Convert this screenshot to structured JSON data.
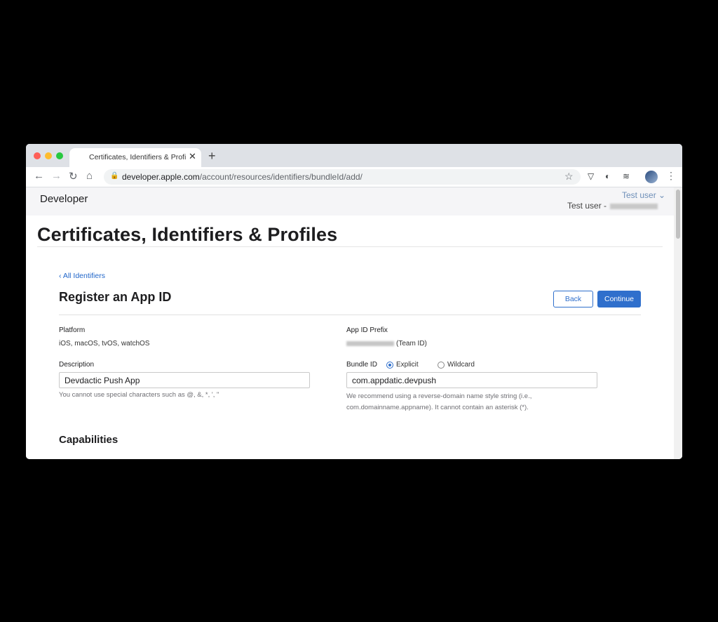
{
  "browser": {
    "tab_title": "Certificates, Identifiers & Profiles",
    "favicon": "apple-icon",
    "url_host": "developer.apple.com",
    "url_path": "/account/resources/identifiers/bundleId/add/"
  },
  "header": {
    "brand": "Developer",
    "user_menu": "Test user",
    "team_label": "Test user -"
  },
  "page": {
    "title": "Certificates, Identifiers & Profiles",
    "back_link": "‹ All Identifiers",
    "section_title": "Register an App ID",
    "back_button": "Back",
    "continue_button": "Continue"
  },
  "form": {
    "platform_label": "Platform",
    "platform_value": "iOS, macOS, tvOS, watchOS",
    "prefix_label": "App ID Prefix",
    "prefix_suffix": "(Team ID)",
    "description_label": "Description",
    "description_value": "Devdactic Push App",
    "description_hint": "You cannot use special characters such as @, &, *, ', \"",
    "bundle_label": "Bundle ID",
    "bundle_options": [
      "Explicit",
      "Wildcard"
    ],
    "bundle_selected": "Explicit",
    "bundle_value": "com.appdatic.devpush",
    "bundle_hint_1": "We recommend using a reverse-domain name style string (i.e.,",
    "bundle_hint_2": "com.domainname.appname). It cannot contain an asterisk (*).",
    "capabilities_title": "Capabilities"
  },
  "colors": {
    "accent": "#2f6fcc",
    "link": "#2166c9",
    "header_bg": "#f5f5f7"
  }
}
